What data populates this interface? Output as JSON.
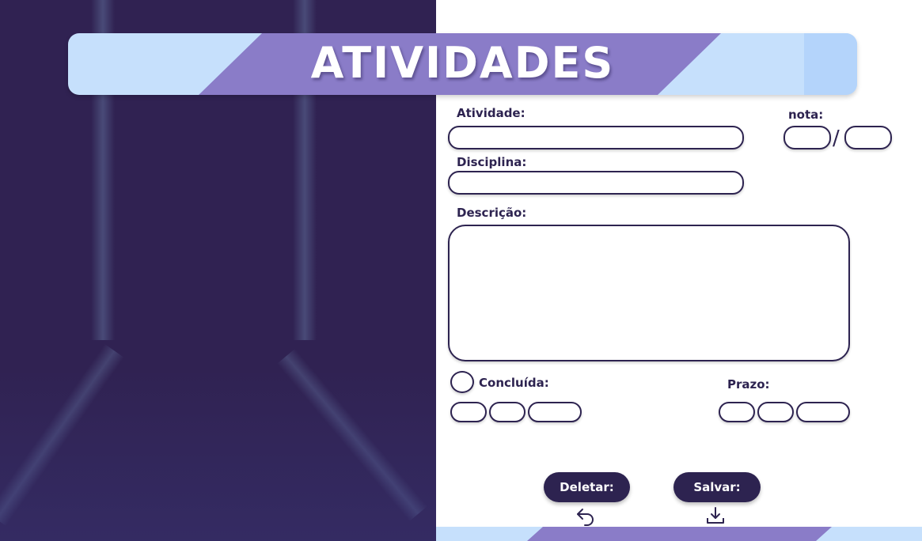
{
  "header": {
    "title": "ATIVIDADES"
  },
  "form": {
    "atividade_label": "Atividade:",
    "atividade_value": "",
    "nota_label": "nota:",
    "nota_value": "",
    "nota_total": "",
    "nota_separator": "/",
    "disciplina_label": "Disciplina:",
    "disciplina_value": "",
    "descricao_label": "Descrição:",
    "descricao_value": "",
    "concluida_label": "Concluída:",
    "concluida_checked": false,
    "concluida_date": {
      "day": "",
      "month": "",
      "year": ""
    },
    "prazo_label": "Prazo:",
    "prazo_date": {
      "day": "",
      "month": "",
      "year": ""
    }
  },
  "actions": {
    "delete_label": "Deletar:",
    "save_label": "Salvar:",
    "delete_icon": "undo-arrow-icon",
    "save_icon": "download-tray-icon"
  },
  "colors": {
    "primary": "#2d2350",
    "left_panel": "#302252",
    "banner_light": "#c6e0fc",
    "banner_accent": "#8a7cc8"
  }
}
